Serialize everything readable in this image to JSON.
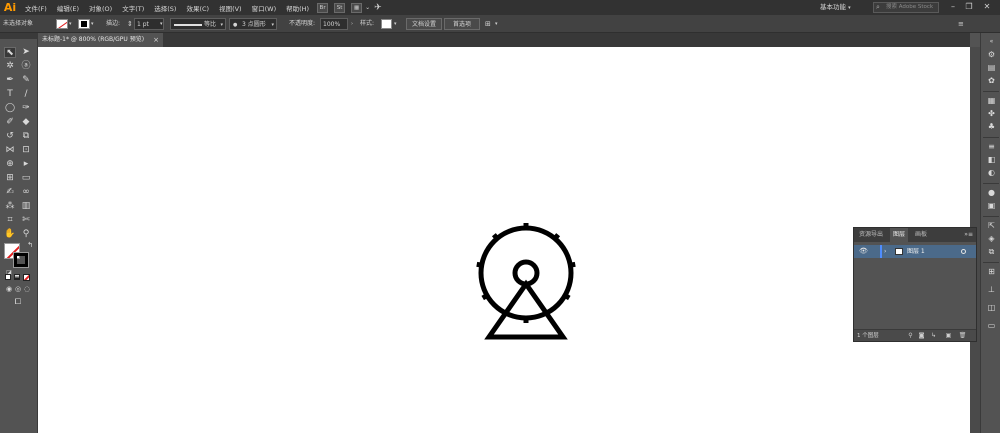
{
  "app": {
    "logo": "Ai",
    "menu": [
      "文件(F)",
      "编辑(E)",
      "对象(O)",
      "文字(T)",
      "选择(S)",
      "效果(C)",
      "视图(V)",
      "窗口(W)",
      "帮助(H)"
    ],
    "bridge_btn": "Br",
    "stock_btn": "St",
    "workspace": "基本功能",
    "stock_search_placeholder": "搜索 Adobe Stock",
    "window_controls": {
      "minimize": "–",
      "restore": "❐",
      "close": "✕"
    }
  },
  "control_bar": {
    "selection_status": "未选择对象",
    "stroke_label": "描边:",
    "stroke_weight": "1 pt",
    "stroke_profile": "等比",
    "brush": "3 点圆形",
    "opacity_label": "不透明度:",
    "opacity_value": "100%",
    "style_label": "样式:",
    "doc_setup_btn": "文档设置",
    "preferences_btn": "首选项"
  },
  "document_tab": {
    "title": "未标题-1* @ 800% (RGB/GPU 预览)",
    "close": "×"
  },
  "layers_panel": {
    "tabs": [
      "资源导出",
      "图层",
      "画板"
    ],
    "active_tab": "图层",
    "layers": [
      {
        "name": "图层 1",
        "visible": true,
        "color": "#4f8dff"
      }
    ],
    "count_text": "1 个图层"
  },
  "colors": {
    "chrome_dark": "#323232",
    "chrome": "#535353",
    "canvas": "#ffffff",
    "layer_selected": "#4b6a8a",
    "logo": "#ff9a00"
  }
}
